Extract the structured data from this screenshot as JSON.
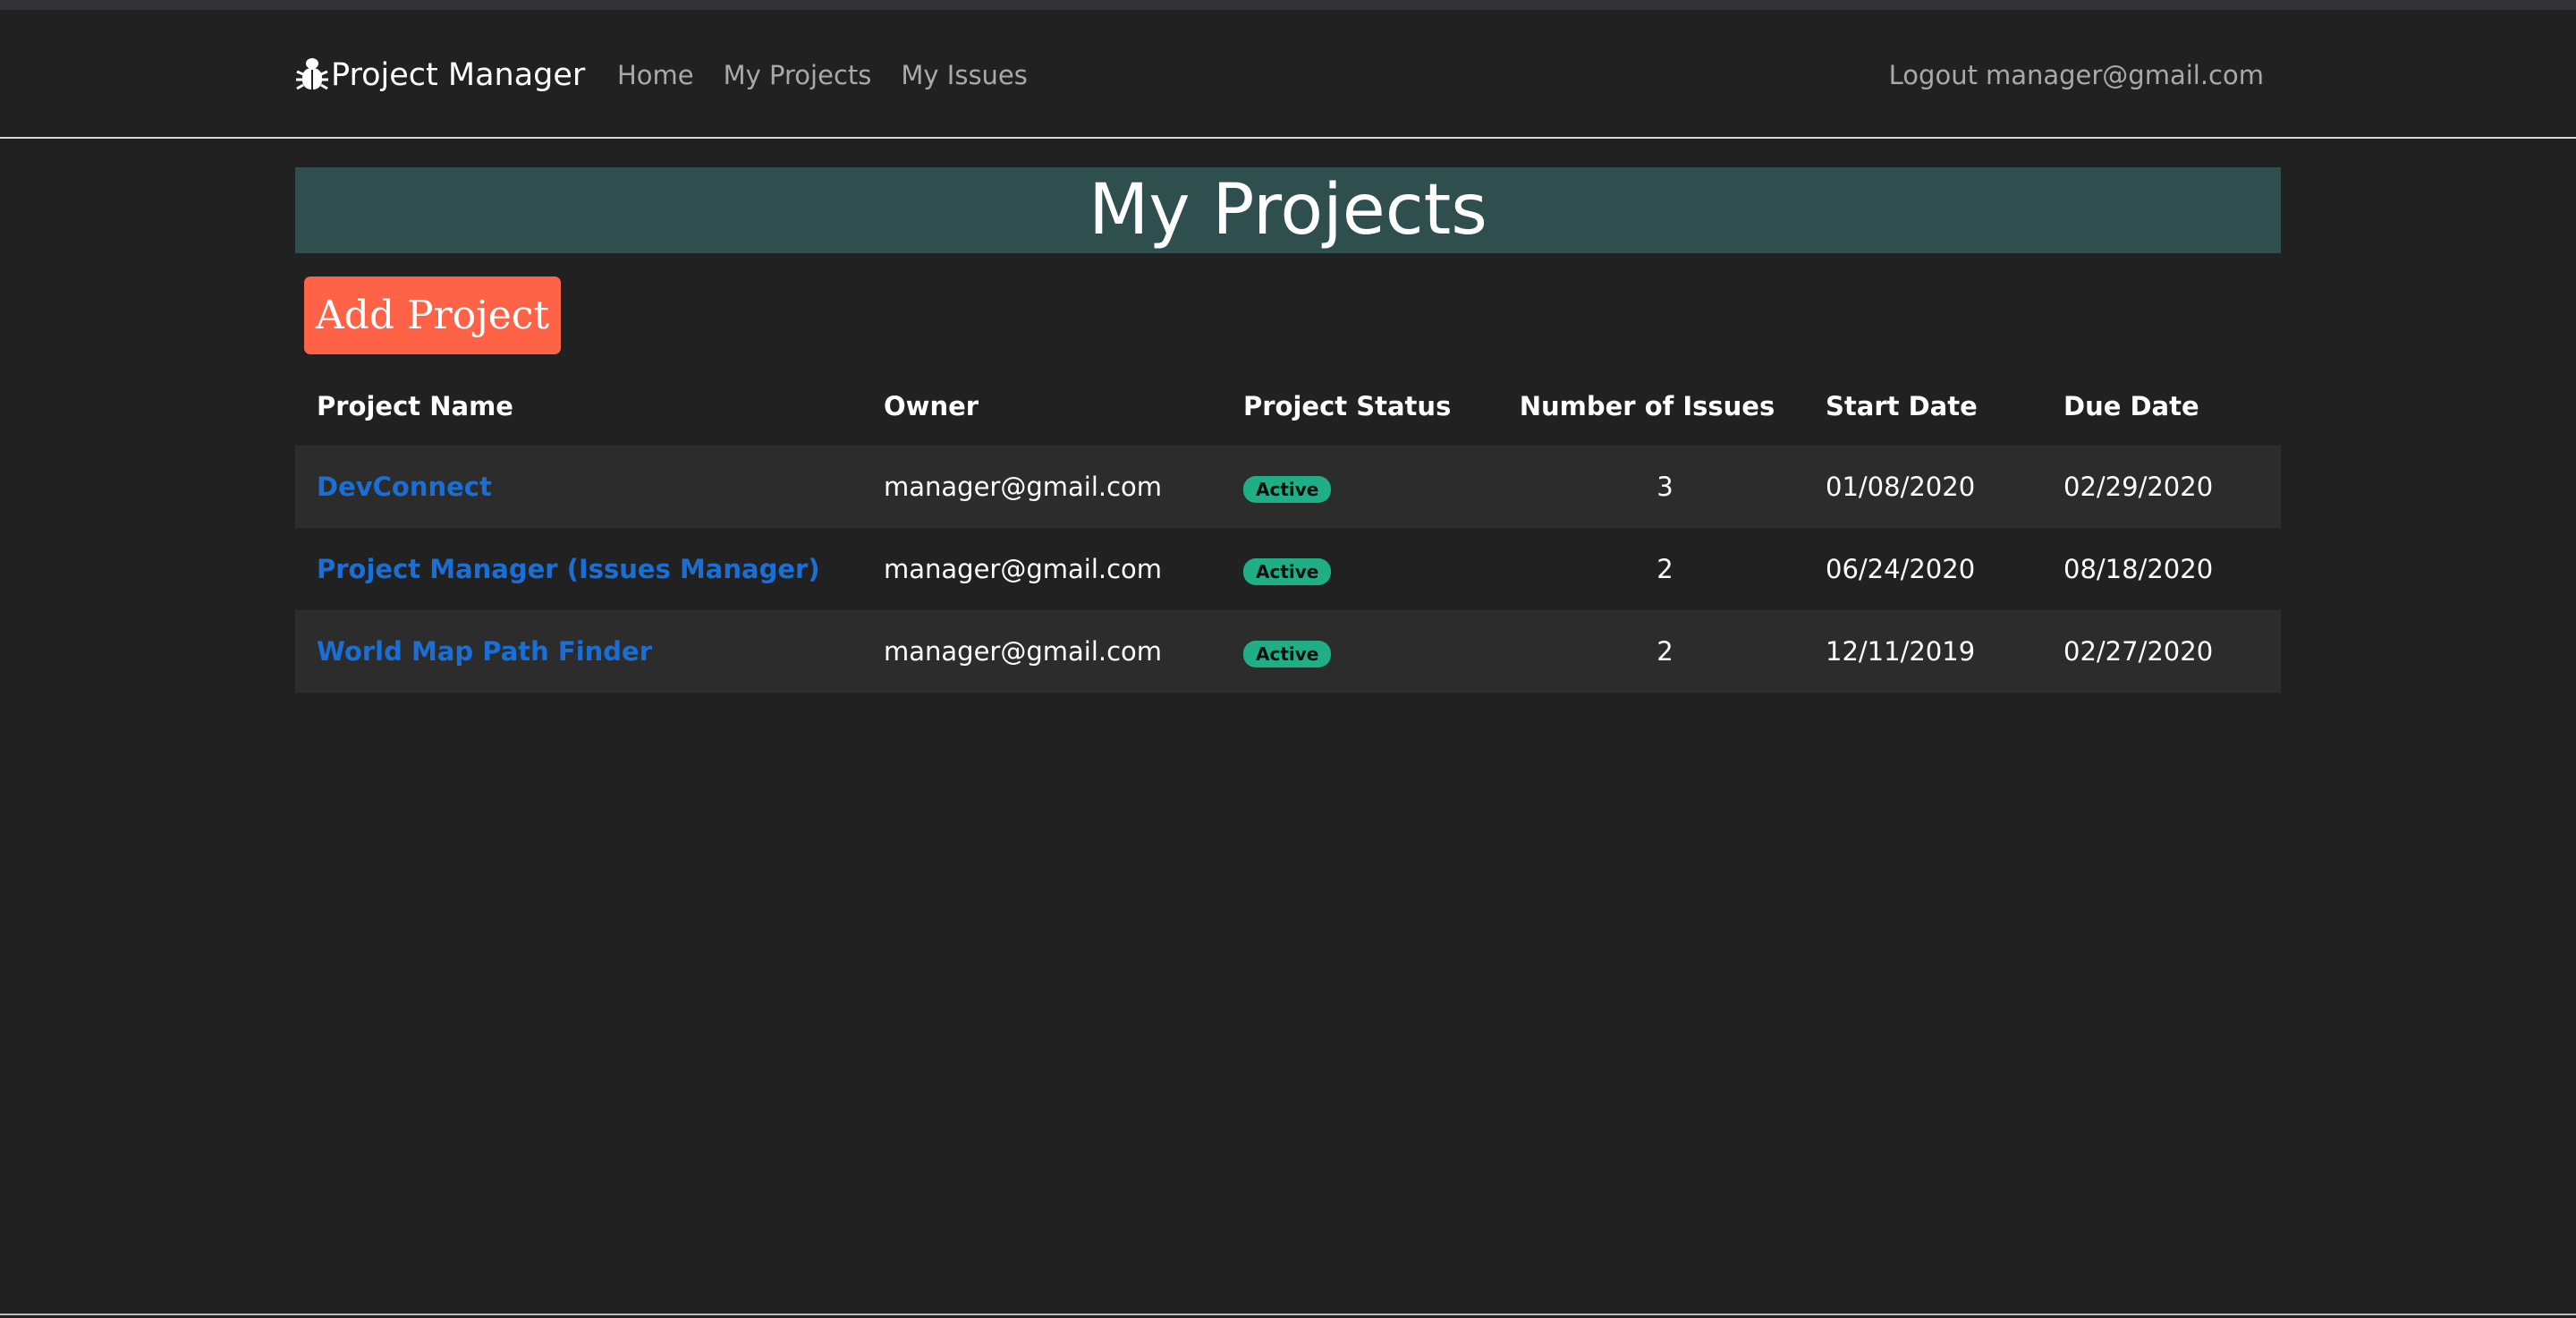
{
  "navbar": {
    "brand": "Project Manager",
    "links": [
      {
        "label": "Home"
      },
      {
        "label": "My Projects"
      },
      {
        "label": "My Issues"
      }
    ],
    "logout_label": "Logout",
    "user_email": "manager@gmail.com"
  },
  "page": {
    "title": "My Projects",
    "add_button_label": "Add Project"
  },
  "table": {
    "headers": [
      "Project Name",
      "Owner",
      "Project Status",
      "Number of Issues",
      "Start Date",
      "Due Date"
    ],
    "rows": [
      {
        "name": "DevConnect",
        "owner": "manager@gmail.com",
        "status": "Active",
        "issues": "3",
        "start": "01/08/2020",
        "due": "02/29/2020"
      },
      {
        "name": "Project Manager (Issues Manager)",
        "owner": "manager@gmail.com",
        "status": "Active",
        "issues": "2",
        "start": "06/24/2020",
        "due": "08/18/2020"
      },
      {
        "name": "World Map Path Finder",
        "owner": "manager@gmail.com",
        "status": "Active",
        "issues": "2",
        "start": "12/11/2019",
        "due": "02/27/2020"
      }
    ]
  },
  "colors": {
    "background": "#212121",
    "title_bar": "#2f4f4f",
    "add_button": "#ff6347",
    "link": "#1a6fd6",
    "status_badge": "#1fae85"
  },
  "icons": {
    "brand": "bug-icon"
  }
}
